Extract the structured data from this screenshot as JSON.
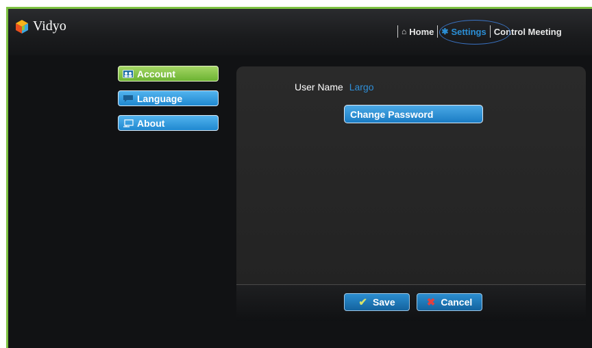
{
  "app": {
    "logo_text": "Vidyo"
  },
  "nav": {
    "home_label": "Home",
    "settings_label": "Settings",
    "control_label": "Control Meeting",
    "active": "Settings"
  },
  "sidebar": {
    "items": [
      {
        "label": "Account",
        "icon": "account-icon",
        "active": true
      },
      {
        "label": "Language",
        "icon": "speech-bubble-icon",
        "active": false
      },
      {
        "label": "About",
        "icon": "monitor-icon",
        "active": false
      }
    ]
  },
  "account": {
    "user_name_label": "User Name",
    "user_name_value": "Largo",
    "change_password_label": "Change Password"
  },
  "actions": {
    "save_label": "Save",
    "cancel_label": "Cancel"
  },
  "colors": {
    "accent_green": "#7dc242",
    "accent_blue": "#2b8fd6",
    "background": "#111214"
  }
}
